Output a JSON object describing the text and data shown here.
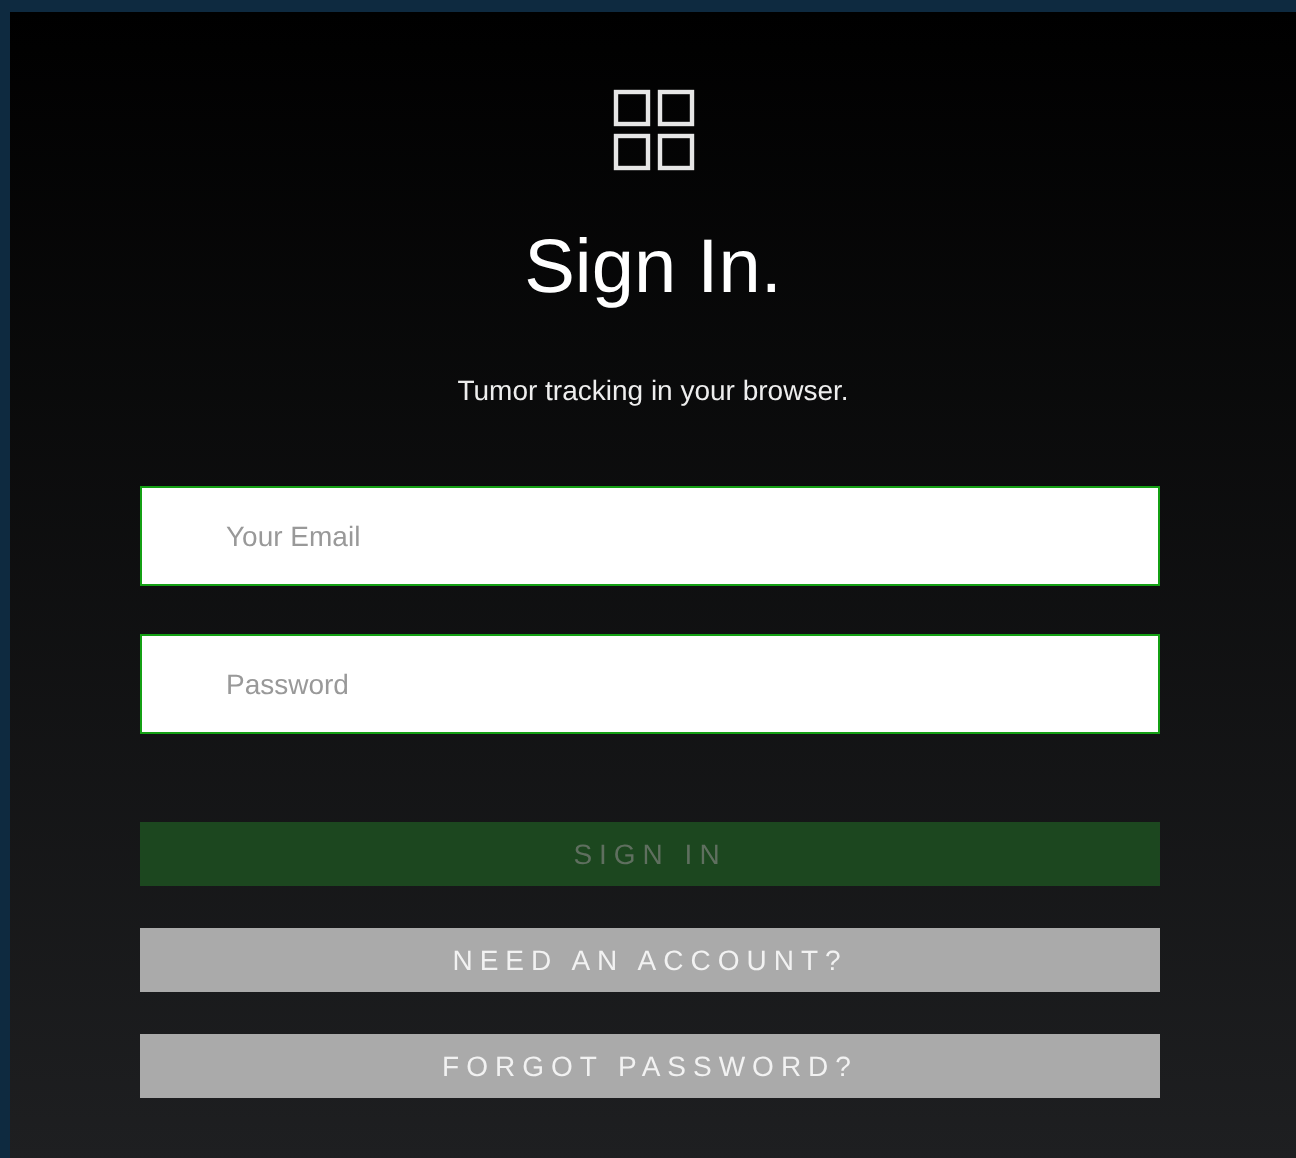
{
  "title": "Sign In.",
  "subtitle": "Tumor tracking in your browser.",
  "fields": [
    {
      "placeholder": "Your Email"
    },
    {
      "placeholder": "Password"
    }
  ],
  "buttons": [
    {
      "label": "SIGN IN",
      "kind": "primary",
      "disabled": true
    },
    {
      "label": "NEED AN ACCOUNT?",
      "kind": "secondary",
      "disabled": false
    },
    {
      "label": "FORGOT PASSWORD?",
      "kind": "secondary",
      "disabled": false
    }
  ]
}
